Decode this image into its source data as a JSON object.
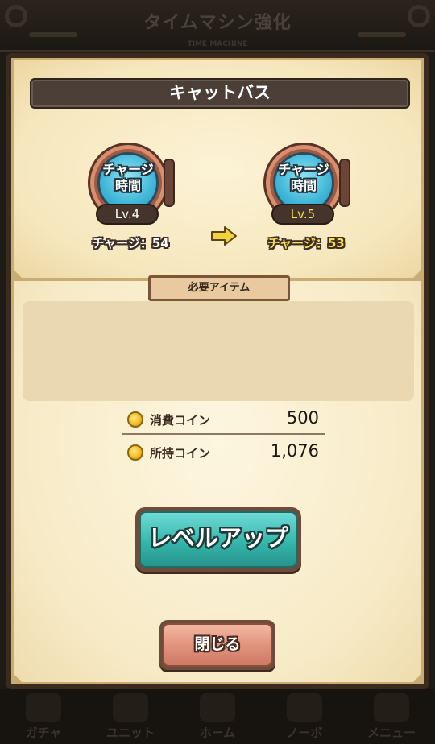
{
  "background": {
    "screen_title": "タイムマシン強化",
    "screen_subtitle": "TIME MACHINE",
    "nav_items": [
      "ガチャ",
      "ユニット",
      "ホーム",
      "ノーボ",
      "メニュー"
    ]
  },
  "dialog": {
    "item_name": "キャットバス",
    "current": {
      "icon_label": "チャージ\n時間",
      "level": "Lv.4",
      "charge_text": "チャージ：54"
    },
    "next": {
      "icon_label": "チャージ\n時間",
      "level": "Lv.5",
      "charge_text": "チャージ：53"
    },
    "required_items_label": "必要アイテム",
    "cost": {
      "label": "消費コイン",
      "value": "500"
    },
    "owned": {
      "label": "所持コイン",
      "value": "1,076"
    },
    "level_up_button": "レベルアップ",
    "close_button": "閉じる"
  },
  "colors": {
    "level_up_button": "#36b6ac",
    "close_button": "#e0907a",
    "panel_bg": "#f7eac6",
    "title_bar": "#4c3f37",
    "arrow": "#f2d33a"
  },
  "icons": [
    "time-machine-medal-icon",
    "arrow-right-icon",
    "coin-icon"
  ]
}
